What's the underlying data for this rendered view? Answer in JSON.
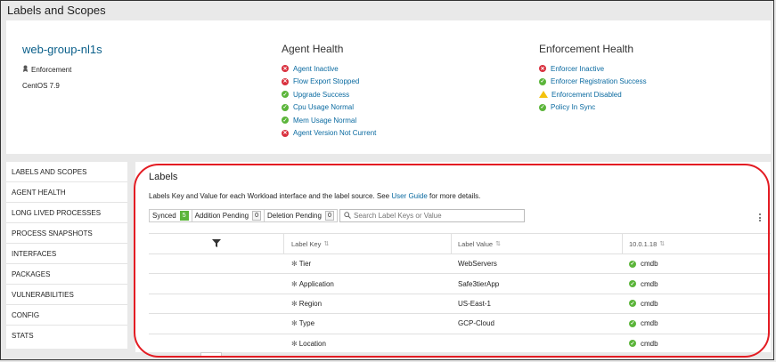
{
  "page_title": "Labels and Scopes",
  "host": {
    "name": "web-group-nl1s",
    "role": "Enforcement",
    "os": "CentOS 7.9"
  },
  "agent_health": {
    "title": "Agent Health",
    "items": [
      {
        "label": "Agent Inactive",
        "status": "error"
      },
      {
        "label": "Flow Export Stopped",
        "status": "error"
      },
      {
        "label": "Upgrade Success",
        "status": "ok"
      },
      {
        "label": "Cpu Usage Normal",
        "status": "ok"
      },
      {
        "label": "Mem Usage Normal",
        "status": "ok"
      },
      {
        "label": "Agent Version Not Current",
        "status": "error"
      }
    ]
  },
  "enforcement_health": {
    "title": "Enforcement Health",
    "items": [
      {
        "label": "Enforcer Inactive",
        "status": "error"
      },
      {
        "label": "Enforcer Registration Success",
        "status": "ok"
      },
      {
        "label": "Enforcement Disabled",
        "status": "warning"
      },
      {
        "label": "Policy In Sync",
        "status": "ok"
      }
    ]
  },
  "sidebar": {
    "items": [
      "LABELS AND SCOPES",
      "AGENT HEALTH",
      "LONG LIVED PROCESSES",
      "PROCESS SNAPSHOTS",
      "INTERFACES",
      "PACKAGES",
      "VULNERABILITIES",
      "CONFIG",
      "STATS"
    ]
  },
  "labels_panel": {
    "title": "Labels",
    "description_prefix": "Labels Key and Value for each Workload interface and the label source. See ",
    "user_guide_link": "User Guide",
    "description_suffix": " for more details.",
    "filters": {
      "synced_label": "Synced",
      "synced_count": "5",
      "addition_label": "Addition Pending",
      "addition_count": "0",
      "deletion_label": "Deletion Pending",
      "deletion_count": "0"
    },
    "search_placeholder": "Search Label Keys or Value",
    "columns": {
      "key": "Label Key",
      "value": "Label Value",
      "ip": "10.0.1.18"
    },
    "rows": [
      {
        "key": "Tier",
        "value": "WebServers",
        "source": "cmdb"
      },
      {
        "key": "Application",
        "value": "Safe3tierApp",
        "source": "cmdb"
      },
      {
        "key": "Region",
        "value": "US-East-1",
        "source": "cmdb"
      },
      {
        "key": "Type",
        "value": "GCP-Cloud",
        "source": "cmdb"
      },
      {
        "key": "Location",
        "value": "",
        "source": "cmdb"
      }
    ]
  },
  "colors": {
    "link": "#0a6aa0",
    "error": "#d9303e",
    "ok": "#5bb53a",
    "warning": "#f4c20d",
    "highlight_ring": "#e31c23"
  },
  "icons": {
    "role": "badge-icon",
    "error": "x-circle-icon",
    "ok": "check-circle-icon",
    "warning": "warning-triangle-icon",
    "filter": "funnel-icon",
    "search": "search-icon",
    "more": "kebab-menu-icon",
    "sort": "sort-arrows-icon",
    "key_marker": "asterisk-icon"
  }
}
